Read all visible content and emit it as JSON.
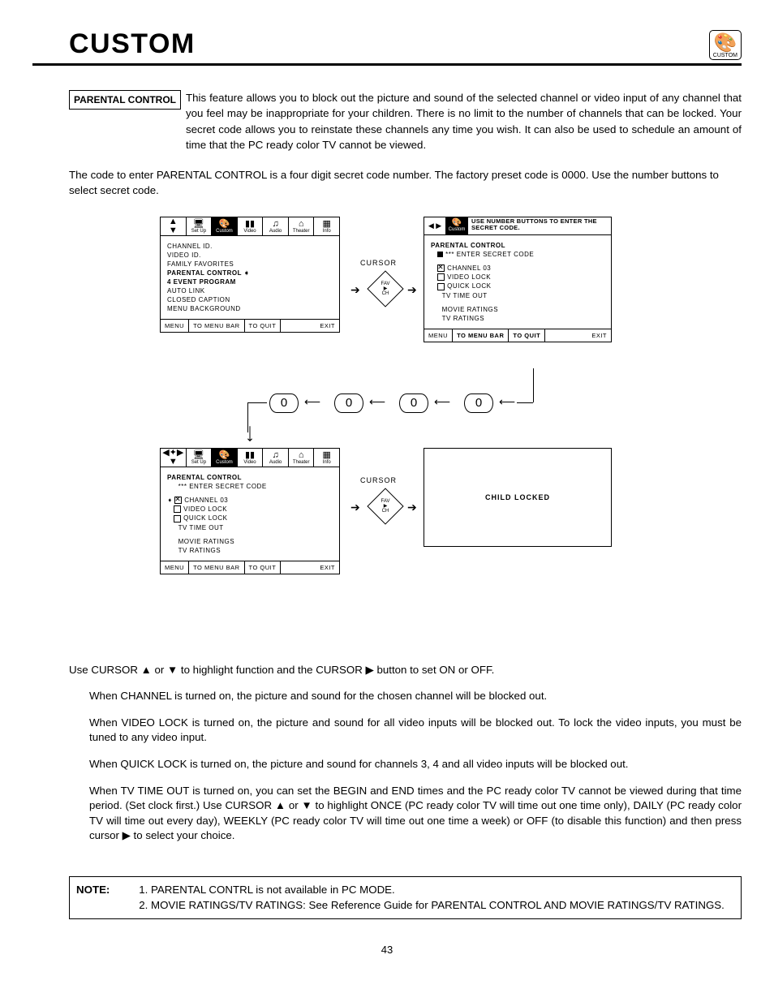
{
  "header": {
    "title": "CUSTOM",
    "iconLabel": "CUSTOM"
  },
  "labels": {
    "parentalControl": "PARENTAL CONTROL"
  },
  "intro": "This feature allows you to block out the picture and sound of the selected channel or video input of any channel that you feel may be inappropriate for your children. There is no limit to the number of channels that can be locked. Your secret code allows you to reinstate these channels any time you wish. It can also be used to schedule an amount of time that the PC ready color TV cannot be viewed.",
  "codeText": "The code to enter PARENTAL CONTROL is a four digit secret code number.  The factory preset code is 0000. Use the number buttons to select secret code.",
  "menuIcons": [
    "Set Up",
    "Custom",
    "Video",
    "Audio",
    "Theater",
    "Info"
  ],
  "menu1Items": [
    "CHANNEL ID.",
    "VIDEO ID.",
    "FAMILY FAVORITES",
    "PARENTAL CONTROL",
    "4 EVENT PROGRAM",
    "AUTO LINK",
    "CLOSED CAPTION",
    "MENU BACKGROUND"
  ],
  "footer": {
    "a": "MENU",
    "b": "TO MENU BAR",
    "c": "TO QUIT",
    "d": "EXIT"
  },
  "smallMsg": "USE NUMBER BUTTONS TO ENTER THE SECRET CODE.",
  "pcHeading": "PARENTAL CONTROL",
  "enterSecret": "*** ENTER SECRET CODE",
  "pcItems": [
    "CHANNEL 03",
    "VIDEO LOCK",
    "QUICK LOCK",
    "TV TIME OUT",
    "",
    "MOVIE RATINGS",
    "TV RATINGS"
  ],
  "cursor": "CURSOR",
  "fav": {
    "top": "FAV",
    "mid": "▶",
    "bot": "CH"
  },
  "code": [
    "0",
    "0",
    "0",
    "0"
  ],
  "childLocked": "CHILD LOCKED",
  "para1": "Use CURSOR ▲ or ▼ to highlight function and the CURSOR ▶ button to set ON or OFF.",
  "para2": "When CHANNEL is turned on, the picture and sound for the chosen channel will be blocked out.",
  "para3": "When VIDEO LOCK is turned on, the picture and sound for all video inputs will be blocked out. To lock the video inputs, you must be tuned to any video input.",
  "para4": "When QUICK LOCK is turned on, the picture and sound for channels 3, 4 and all video inputs will be blocked out.",
  "para5": "When TV TIME OUT is turned on, you can set the BEGIN and END times and the PC ready color TV cannot be viewed during that time period. (Set clock first.) Use CURSOR ▲ or ▼ to highlight ONCE (PC ready color TV will time out one time only), DAILY (PC ready color TV will time out every day), WEEKLY (PC ready color TV will time out one time a week) or OFF (to disable this function) and then press cursor ▶ to select your choice.",
  "note": {
    "label": "NOTE:",
    "items": [
      "PARENTAL CONTRL is not available in PC MODE.",
      "MOVIE RATINGS/TV RATINGS:  See Reference Guide for PARENTAL CONTROL AND MOVIE RATINGS/TV RATINGS."
    ]
  },
  "pageNumber": "43"
}
